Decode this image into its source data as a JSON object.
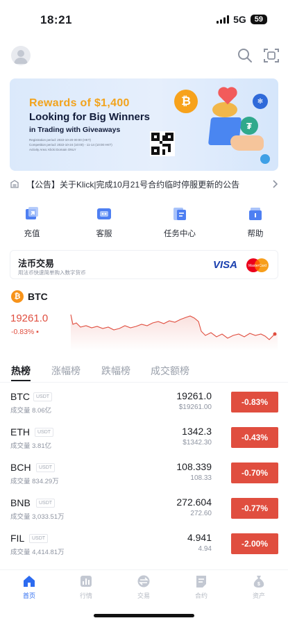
{
  "status_bar": {
    "time": "18:21",
    "network": "5G",
    "battery": "59"
  },
  "banner": {
    "reward_text": "Rewards of $1,400",
    "title": "Looking for Big Winners",
    "subtitle": "in Trading with Giveaways",
    "fine_print": [
      "Registration period: 2022-10-20 00:00 (HKT)",
      "Competition period: 2022-10-24 (10:00) - 11-14 (10:00 HKT)",
      "Activity Area: Klicki Domain ONLY"
    ]
  },
  "notice": {
    "text": "【公告】关于Klick|完成10月21号合约临时停服更新的公告"
  },
  "quick_actions": [
    {
      "label": "充值",
      "icon": "deposit-icon"
    },
    {
      "label": "客服",
      "icon": "support-icon"
    },
    {
      "label": "任务中心",
      "icon": "task-center-icon"
    },
    {
      "label": "帮助",
      "icon": "help-icon"
    }
  ],
  "fiat": {
    "title": "法币交易",
    "subtitle": "用法币快速简单购入数字货币",
    "visa": "VISA",
    "mastercard": "MasterCard"
  },
  "btc_summary": {
    "symbol": "BTC",
    "price": "19261.0",
    "change": "-0.83% ▪"
  },
  "tabs": [
    "热榜",
    "涨幅榜",
    "跌幅榜",
    "成交额榜"
  ],
  "market_rows": [
    {
      "symbol": "BTC",
      "quote": "USDT",
      "volume": "成交量 8.06亿",
      "price": "19261.0",
      "fiat": "$19261.00",
      "change": "-0.83%"
    },
    {
      "symbol": "ETH",
      "quote": "USDT",
      "volume": "成交量 3.81亿",
      "price": "1342.3",
      "fiat": "$1342.30",
      "change": "-0.43%"
    },
    {
      "symbol": "BCH",
      "quote": "USDT",
      "volume": "成交量 834.29万",
      "price": "108.339",
      "fiat": "108.33",
      "change": "-0.70%"
    },
    {
      "symbol": "BNB",
      "quote": "USDT",
      "volume": "成交量 3,033.51万",
      "price": "272.604",
      "fiat": "272.60",
      "change": "-0.77%"
    },
    {
      "symbol": "FIL",
      "quote": "USDT",
      "volume": "成交量 4,414.81万",
      "price": "4.941",
      "fiat": "4.94",
      "change": "-2.00%"
    }
  ],
  "bottom_nav": [
    {
      "label": "首页",
      "icon": "home-icon",
      "active": true
    },
    {
      "label": "行情",
      "icon": "market-icon",
      "active": false
    },
    {
      "label": "交易",
      "icon": "trade-icon",
      "active": false
    },
    {
      "label": "合约",
      "icon": "contract-icon",
      "active": false
    },
    {
      "label": "资产",
      "icon": "assets-icon",
      "active": false
    }
  ],
  "colors": {
    "accent": "#2c6bf0",
    "down": "#e04e3f",
    "reward": "#f2a31c"
  }
}
